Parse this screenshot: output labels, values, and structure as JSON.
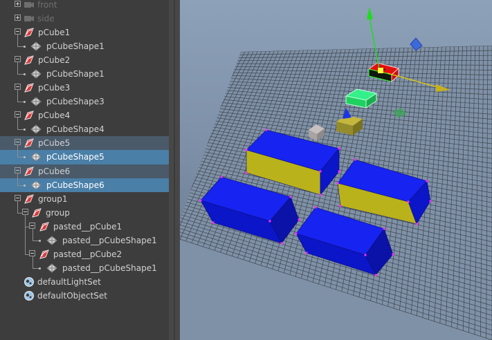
{
  "outliner": {
    "items": [
      {
        "label": "front",
        "icon": "camera-icon",
        "kind": "camera"
      },
      {
        "label": "side",
        "icon": "camera-icon",
        "kind": "camera"
      },
      {
        "label": "pCube1",
        "icon": "transform-icon",
        "kind": "transform"
      },
      {
        "label": "pCubeShape1",
        "icon": "mesh-shape-icon",
        "kind": "shape"
      },
      {
        "label": "pCube2",
        "icon": "transform-icon",
        "kind": "transform"
      },
      {
        "label": "pCubeShape1",
        "icon": "mesh-shape-icon",
        "kind": "shape"
      },
      {
        "label": "pCube3",
        "icon": "transform-icon",
        "kind": "transform"
      },
      {
        "label": "pCubeShape3",
        "icon": "mesh-shape-icon",
        "kind": "shape"
      },
      {
        "label": "pCube4",
        "icon": "transform-icon",
        "kind": "transform"
      },
      {
        "label": "pCubeShape4",
        "icon": "mesh-shape-icon",
        "kind": "shape"
      },
      {
        "label": "pCube5",
        "icon": "transform-icon",
        "kind": "transform"
      },
      {
        "label": "pCubeShape5",
        "icon": "mesh-shape-icon",
        "kind": "shape"
      },
      {
        "label": "pCube6",
        "icon": "transform-icon",
        "kind": "transform"
      },
      {
        "label": "pCubeShape6",
        "icon": "mesh-shape-icon",
        "kind": "shape"
      },
      {
        "label": "group1",
        "icon": "group-icon",
        "kind": "group"
      },
      {
        "label": "group",
        "icon": "group-icon",
        "kind": "group"
      },
      {
        "label": "pasted__pCube1",
        "icon": "transform-icon",
        "kind": "transform"
      },
      {
        "label": "pasted__pCubeShape1",
        "icon": "mesh-shape-icon",
        "kind": "shape"
      },
      {
        "label": "pasted__pCube2",
        "icon": "transform-icon",
        "kind": "transform"
      },
      {
        "label": "pasted__pCubeShape1",
        "icon": "mesh-shape-icon",
        "kind": "shape"
      },
      {
        "label": "defaultLightSet",
        "icon": "set-icon",
        "kind": "set"
      },
      {
        "label": "defaultObjectSet",
        "icon": "set-icon",
        "kind": "set"
      }
    ],
    "selected": [
      "pCubeShape5",
      "pCubeShape6"
    ]
  },
  "viewport": {
    "grid_color": "#3f4650",
    "background_top": "#8da1b8",
    "background_bottom": "#5f6f85",
    "cube_front_color": "#0b16c8",
    "cube_top_color": "#1723f0",
    "cube_side_color": "#b9b21a",
    "selected_cube_color": "#e20f0f",
    "manipulator_y_color": "#1edc1e",
    "manipulator_x_color": "#d8c41c"
  }
}
